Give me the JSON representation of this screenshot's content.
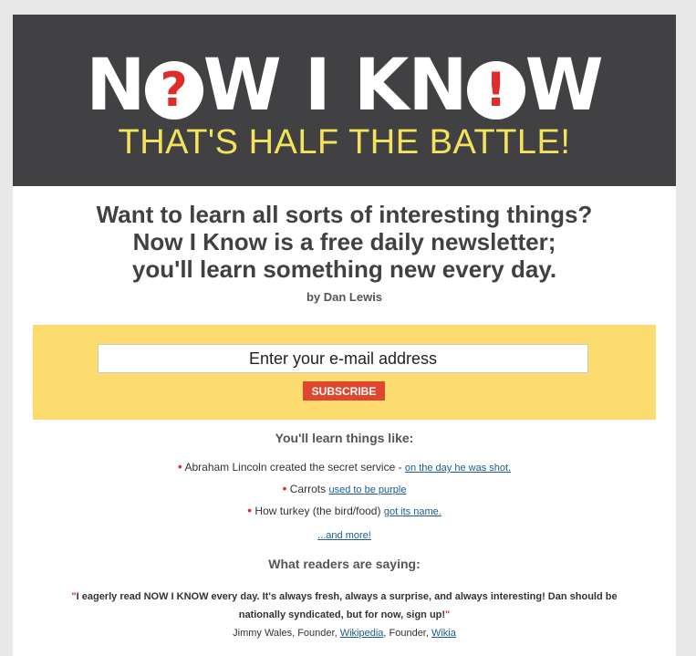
{
  "header": {
    "logo_left": "N",
    "logo_q1": "?",
    "logo_mid": "W I KN",
    "logo_q2": "!",
    "logo_right": "W",
    "tagline": "THAT'S HALF THE BATTLE!"
  },
  "intro": {
    "line1": "Want to learn all sorts of interesting things?",
    "line2": "Now I Know is a free daily newsletter;",
    "line3": "you'll learn something new every day.",
    "byline": "by Dan Lewis"
  },
  "signup": {
    "email_placeholder": "Enter your e-mail address",
    "subscribe_label": "SUBSCRIBE"
  },
  "learn": {
    "title": "You'll learn things like:",
    "items": [
      {
        "bullet": "•",
        "text": "Abraham Lincoln created the secret service - ",
        "link": "on the day he was shot."
      },
      {
        "bullet": "•",
        "text": "Carrots ",
        "link": "used to be purple"
      },
      {
        "bullet": "•",
        "text": "How turkey (the bird/food) ",
        "link": "got its name."
      }
    ],
    "more_link": "...and more!"
  },
  "readers": {
    "title": "What readers are saying:",
    "open_quote": "\"",
    "quote": "I eagerly read NOW I KNOW every day. It's always fresh, always a surprise, and always interesting! Dan should be nationally syndicated, but for now, sign up!",
    "close_quote": "\"",
    "attrib_name": "Jimmy Wales, Founder, ",
    "attrib_link1": "Wikipedia",
    "attrib_mid": ", Founder, ",
    "attrib_link2": "Wikia"
  },
  "colors": {
    "header_bg": "#414042",
    "tagline": "#f2e25c",
    "signup_bg": "#fcdc6e",
    "accent_red": "#e02b2b",
    "subscribe_bg": "#e0452f",
    "link": "#1a5c8c"
  }
}
